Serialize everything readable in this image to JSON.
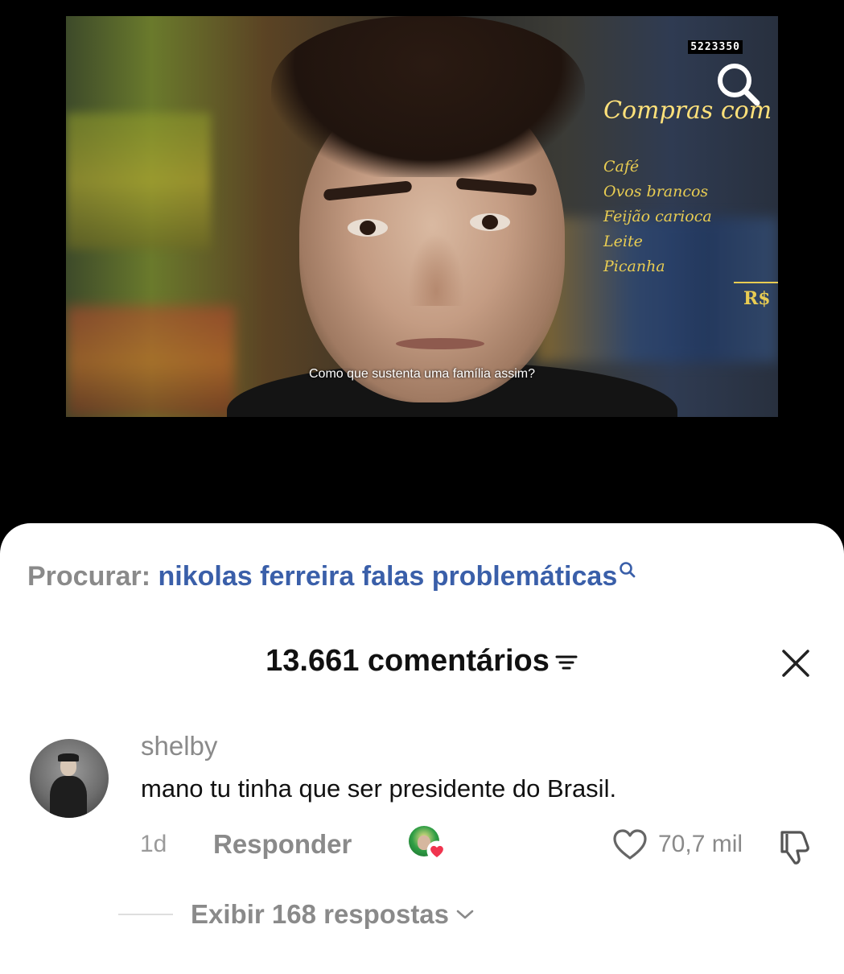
{
  "video": {
    "counter": "5223350",
    "list_title": "Compras com",
    "list_items": [
      "Café",
      "Ovos brancos",
      "Feijão carioca",
      "Leite",
      "Picanha"
    ],
    "currency": "R$",
    "subtitle": "Como que sustenta uma família assim?"
  },
  "search": {
    "prefix": "Procurar:",
    "query": "nikolas ferreira falas problemáticas"
  },
  "comments_header": {
    "count_label": "13.661 comentários"
  },
  "comment": {
    "username": "shelby",
    "text": "mano tu tinha que ser presidente do Brasil.",
    "time": "1d",
    "reply_label": "Responder",
    "like_count": "70,7 mil",
    "view_replies_label": "Exibir 168 respostas"
  },
  "icons": {
    "search": "search-icon",
    "sort": "sort-icon",
    "close": "close-icon",
    "heart": "heart-icon",
    "dislike": "thumbs-down-icon",
    "chevron": "chevron-down-icon"
  },
  "colors": {
    "query_link": "#3a5fa9",
    "secondary_text": "#8a8a8a",
    "creator_heart": "#f0344e",
    "sheet_bg": "#ffffff",
    "backdrop": "#000000"
  }
}
